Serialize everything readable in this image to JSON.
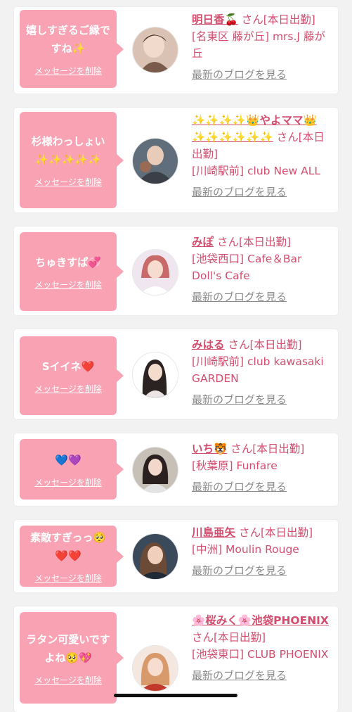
{
  "labels": {
    "delete_message": "メッセージを削除",
    "blog_link": "最新のブログを見る"
  },
  "colors": {
    "bubble": "#f8a2b3",
    "accent": "#d24e6e",
    "background": "#f2f2f2"
  },
  "cards": [
    {
      "message": "嬉しすぎるご縁ですね✨",
      "name": "明日香🍒",
      "suffix": "さん[本日出勤]",
      "shop": "[名東区 藤が丘] mrs.J 藤が丘",
      "avatar_icon": "profile-photo"
    },
    {
      "message": "杉様わっしょい✨✨✨✨✨",
      "name": "✨✨✨✨👑やよママ👑✨✨✨✨✨✨",
      "suffix": "さん[本日出勤]",
      "shop": "[川崎駅前] club New ALL",
      "avatar_icon": "profile-photo"
    },
    {
      "message": "ちゅきすぱ💞",
      "name": "みぽ",
      "suffix": "さん[本日出勤]",
      "shop": "[池袋西口] Cafe＆Bar Doll's Cafe",
      "avatar_icon": "profile-photo"
    },
    {
      "message": "Sイイネ❤️",
      "name": "みはる",
      "suffix": "さん[本日出勤]",
      "shop": "[川崎駅前] club kawasaki GARDEN",
      "avatar_icon": "profile-photo"
    },
    {
      "message": "💙💜",
      "name": "いち🐯",
      "suffix": "さん[本日出勤]",
      "shop": "[秋葉原] Funfare",
      "avatar_icon": "profile-photo"
    },
    {
      "message": "素敵すぎっっ🥺❤️❤️",
      "name": "川島亜矢",
      "suffix": "さん[本日出勤]",
      "shop": "[中洲] Moulin Rouge",
      "avatar_icon": "profile-photo"
    },
    {
      "message": "ラタン可愛いですよね🥺💖",
      "name": "🌸桜みく🌸池袋PHOENIX",
      "suffix": "さん[本日出勤]",
      "shop": "[池袋東口] CLUB PHOENIX",
      "avatar_icon": "profile-photo"
    }
  ]
}
